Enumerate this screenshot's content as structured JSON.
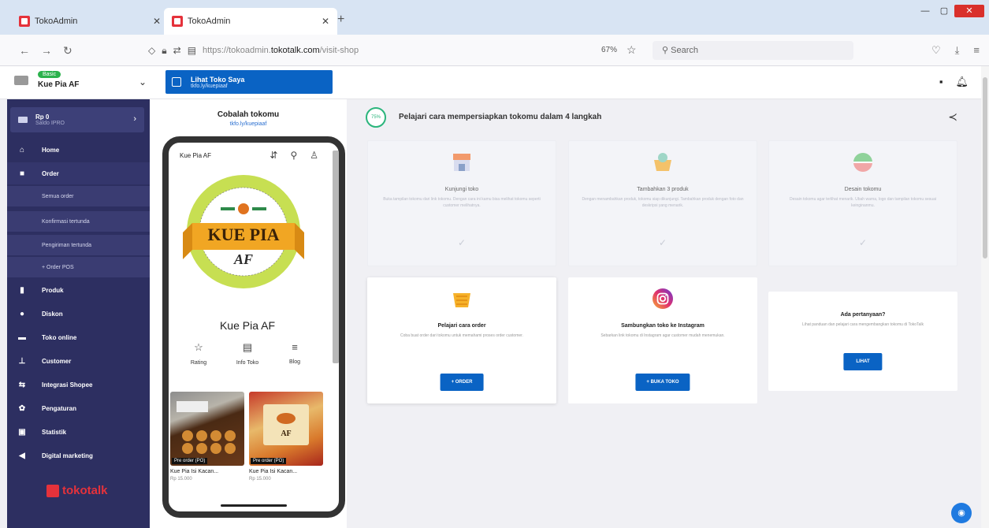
{
  "browser": {
    "tabs": [
      {
        "label": "TokoAdmin"
      },
      {
        "label": "TokoAdmin"
      }
    ],
    "url_prefix": "https://tokoadmin.",
    "url_domain": "tokotalk.com",
    "url_path": "/visit-shop",
    "zoom": "67%",
    "search_placeholder": "Search"
  },
  "header": {
    "store_badge": "Basic",
    "store_name": "Kue Pia AF",
    "visit_title": "Lihat Toko Saya",
    "visit_sub": "tkfo.ly/kuepiaaf"
  },
  "sidebar": {
    "balance_title": "Rp 0",
    "balance_sub": "Saldo IPRO",
    "menu": [
      {
        "label": "Home",
        "icon": "home-icon"
      },
      {
        "label": "Order",
        "icon": "bag-icon"
      }
    ],
    "submenu": [
      "Semua order",
      "Konfirmasi tertunda",
      "Pengiriman tertunda",
      "+ Order POS"
    ],
    "menu2": [
      {
        "label": "Produk",
        "icon": "product-icon"
      },
      {
        "label": "Diskon",
        "icon": "discount-icon"
      },
      {
        "label": "Toko online",
        "icon": "store-icon"
      },
      {
        "label": "Customer",
        "icon": "user-icon"
      },
      {
        "label": "Integrasi Shopee",
        "icon": "integration-icon"
      },
      {
        "label": "Pengaturan",
        "icon": "settings-icon"
      },
      {
        "label": "Statistik",
        "icon": "stats-icon"
      },
      {
        "label": "Digital marketing",
        "icon": "marketing-icon"
      }
    ],
    "logo_text": "tokotalk"
  },
  "preview": {
    "title": "Cobalah tokomu",
    "subtitle": "tkfo.ly/kuepiaaf",
    "phone_store": "Kue Pia AF",
    "logo_line1": "KUE PIA",
    "logo_line2": "AF",
    "store_name": "Kue Pia AF",
    "actions": [
      {
        "label": "Rating"
      },
      {
        "label": "Info Toko"
      },
      {
        "label": "Blog"
      }
    ],
    "products": [
      {
        "badge": "Pre order (PO)",
        "name": "Kue Pia Isi Kacan...",
        "price": "Rp 15.000"
      },
      {
        "badge": "Pre order (PO)",
        "name": "Kue Pia Isi Kacan...",
        "price": "Rp 15.000"
      }
    ]
  },
  "steps": {
    "progress": "75%",
    "title": "Pelajari cara mempersiapkan tokomu dalam 4 langkah",
    "cards": [
      {
        "title": "Kunjungi toko",
        "desc": "Buka tampilan tokomu dari link tokomu. Dengan cara ini kamu bisa melihat tokomu seperti customer melihatnya."
      },
      {
        "title": "Tambahkan 3 produk",
        "desc": "Dengan menambahkan produk, tokomu siap dikunjungi. Tambahkan produk dengan foto dan deskripsi yang menarik."
      },
      {
        "title": "Desain tokomu",
        "desc": "Desain tokomu agar terlihat menarik. Ubah warna, logo dan tampilan tokomu sesuai keinginanmu."
      },
      {
        "title": "Pelajari cara order",
        "desc": "Coba buat order dari tokomu untuk memahami proses order customer.",
        "button": "+ ORDER"
      },
      {
        "title": "Sambungkan toko ke Instagram",
        "desc": "Sebarkan link tokomu di Instagram agar customer mudah menemukan.",
        "button": "+ BUKA TOKO"
      }
    ],
    "faq": {
      "title": "Ada pertanyaan?",
      "desc": "Lihat panduan dan pelajari cara mengembangkan tokomu di TokoTalk",
      "button": "LIHAT"
    }
  }
}
